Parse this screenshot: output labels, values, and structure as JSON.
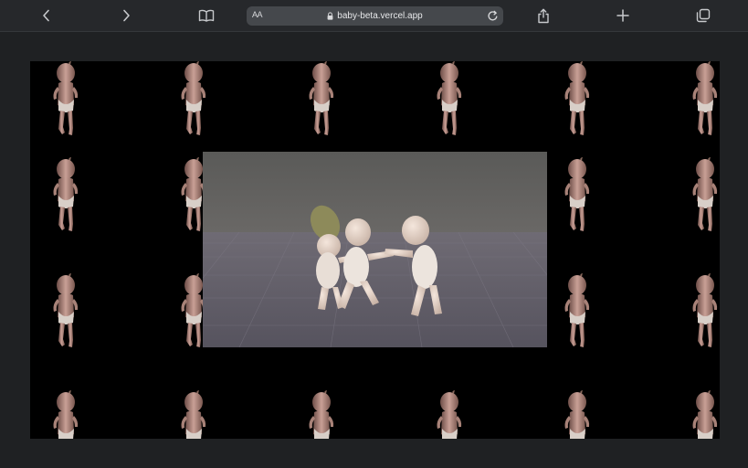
{
  "browser": {
    "address_bar": {
      "text_size_label": "AA",
      "url": "baby-beta.vercel.app"
    },
    "toolbar_icons": [
      "back-icon",
      "forward-icon",
      "bookmarks-icon",
      "reader-text-size-icon",
      "lock-icon",
      "reload-icon",
      "share-icon",
      "new-tab-icon",
      "tabs-icon"
    ]
  },
  "page": {
    "background": "#000000",
    "repeated_image": "dancing-baby",
    "video": "three-dancing-babies"
  },
  "colors": {
    "toolbar": "#26282b",
    "address_bar": "#45484c",
    "page_margin": "#1f2123"
  }
}
